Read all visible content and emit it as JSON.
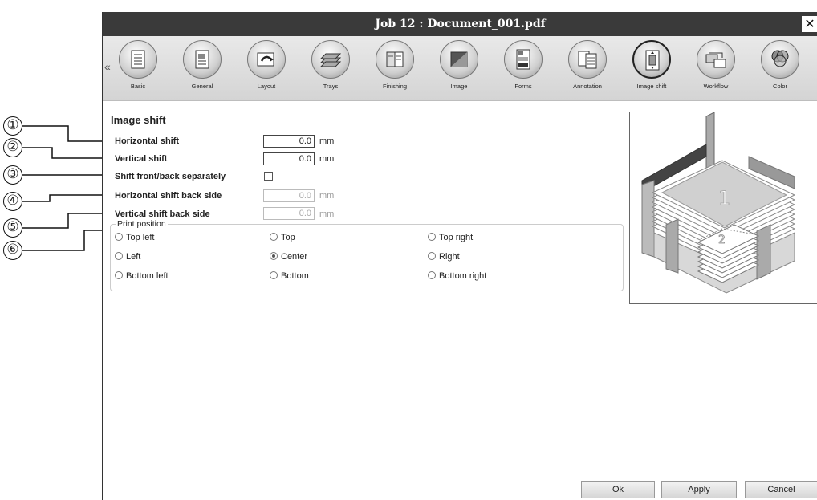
{
  "callouts": [
    "①",
    "②",
    "③",
    "④",
    "⑤",
    "⑥"
  ],
  "window": {
    "title": "Job 12 : Document_001.pdf",
    "close_glyph": "✕"
  },
  "toolbar": {
    "scroll_left": "«",
    "items": [
      {
        "label": "Basic",
        "icon": "basic-icon"
      },
      {
        "label": "General",
        "icon": "general-icon"
      },
      {
        "label": "Layout",
        "icon": "layout-icon"
      },
      {
        "label": "Trays",
        "icon": "trays-icon"
      },
      {
        "label": "Finishing",
        "icon": "finishing-icon"
      },
      {
        "label": "Image",
        "icon": "image-icon"
      },
      {
        "label": "Forms",
        "icon": "forms-icon"
      },
      {
        "label": "Annotation",
        "icon": "annotation-icon"
      },
      {
        "label": "Image shift",
        "icon": "image-shift-icon",
        "active": true
      },
      {
        "label": "Workflow",
        "icon": "workflow-icon"
      },
      {
        "label": "Color",
        "icon": "color-icon"
      }
    ]
  },
  "section": {
    "title": "Image shift",
    "horizontal_shift": {
      "label": "Horizontal shift",
      "value": "0.0",
      "unit": "mm"
    },
    "vertical_shift": {
      "label": "Vertical shift",
      "value": "0.0",
      "unit": "mm"
    },
    "shift_separately": {
      "label": "Shift front/back separately",
      "checked": false
    },
    "horizontal_back": {
      "label": "Horizontal shift back side",
      "value": "0.0",
      "unit": "mm"
    },
    "vertical_back": {
      "label": "Vertical shift back side",
      "value": "0.0",
      "unit": "mm"
    }
  },
  "print_position": {
    "legend": "Print position",
    "options": [
      "Top left",
      "Top",
      "Top right",
      "Left",
      "Center",
      "Right",
      "Bottom left",
      "Bottom",
      "Bottom right"
    ],
    "selected": "Center"
  },
  "preview": {
    "front_label": "1",
    "back_label": "2"
  },
  "buttons": {
    "ok": "Ok",
    "apply": "Apply",
    "cancel": "Cancel"
  }
}
